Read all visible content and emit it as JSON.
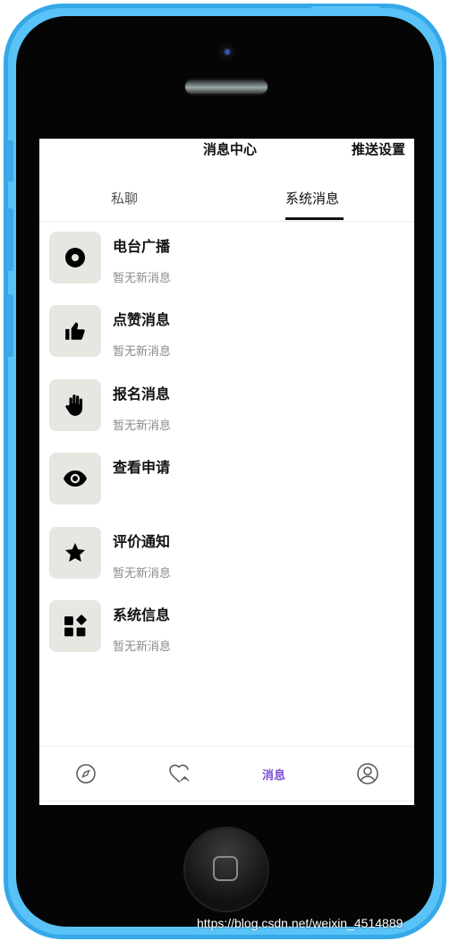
{
  "header": {
    "title": "消息中心",
    "push_settings": "推送设置"
  },
  "tabs": [
    {
      "label": "私聊",
      "active": false
    },
    {
      "label": "系统消息",
      "active": true
    }
  ],
  "messages": [
    {
      "title": "电台广播",
      "subtitle": "暂无新消息",
      "icon": "radio-disc-icon"
    },
    {
      "title": "点赞消息",
      "subtitle": "暂无新消息",
      "icon": "thumbs-up-icon"
    },
    {
      "title": "报名消息",
      "subtitle": "暂无新消息",
      "icon": "hand-icon"
    },
    {
      "title": "查看申请",
      "subtitle": "",
      "icon": "eye-icon"
    },
    {
      "title": "评价通知",
      "subtitle": "暂无新消息",
      "icon": "star-icon"
    },
    {
      "title": "系统信息",
      "subtitle": "暂无新消息",
      "icon": "apps-grid-icon"
    }
  ],
  "bottom_nav": {
    "items": [
      {
        "icon": "compass-icon",
        "label": ""
      },
      {
        "icon": "heart-icon",
        "label": ""
      },
      {
        "icon": "",
        "label": "消息",
        "active": true
      },
      {
        "icon": "user-icon",
        "label": ""
      }
    ]
  },
  "colors": {
    "accent": "#7c4fd8",
    "phone_body": "#59c3f7",
    "icon_bg": "#e8e6e1"
  },
  "watermark": "https://blog.csdn.net/weixin_4514889"
}
